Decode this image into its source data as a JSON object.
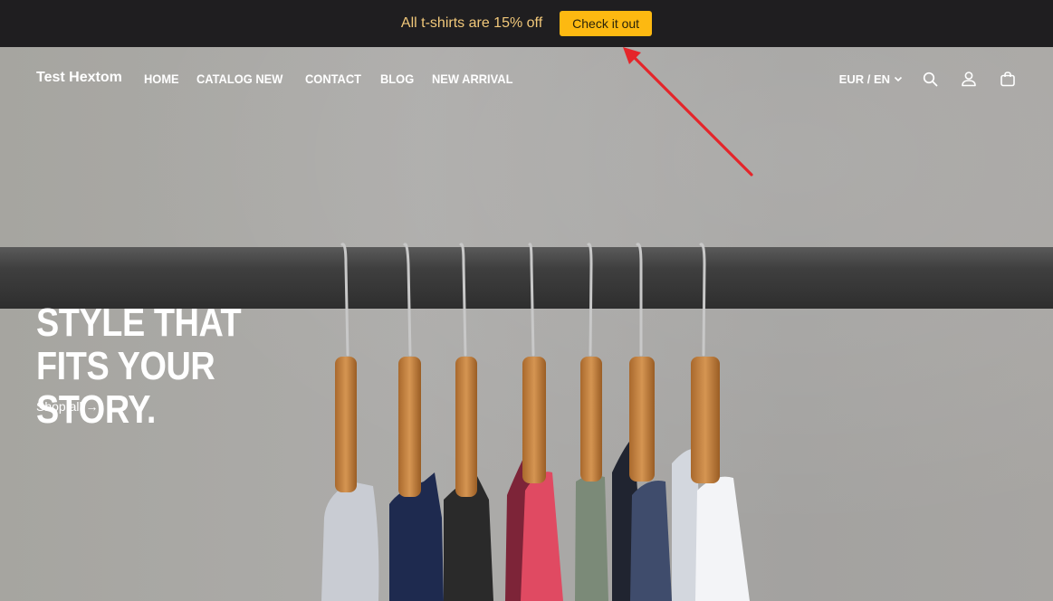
{
  "announcement": {
    "text": "All t-shirts are 15% off",
    "button_label": "Check it out"
  },
  "header": {
    "logo": "Test Hextom",
    "nav": [
      "HOME",
      "CATALOG NEW",
      "CONTACT",
      "BLOG",
      "NEW ARRIVAL"
    ],
    "locale": "EUR / EN",
    "icons": [
      "search-icon",
      "account-icon",
      "cart-icon",
      "chevron-down-icon"
    ]
  },
  "hero": {
    "title": "STYLE THAT FITS YOUR STORY.",
    "link_text": "Shop all →"
  },
  "colors": {
    "announcement_bg": "#1f1e20",
    "announcement_text": "#f1c87a",
    "button_bg": "#fdb911",
    "annotation_arrow": "#e5252a"
  }
}
